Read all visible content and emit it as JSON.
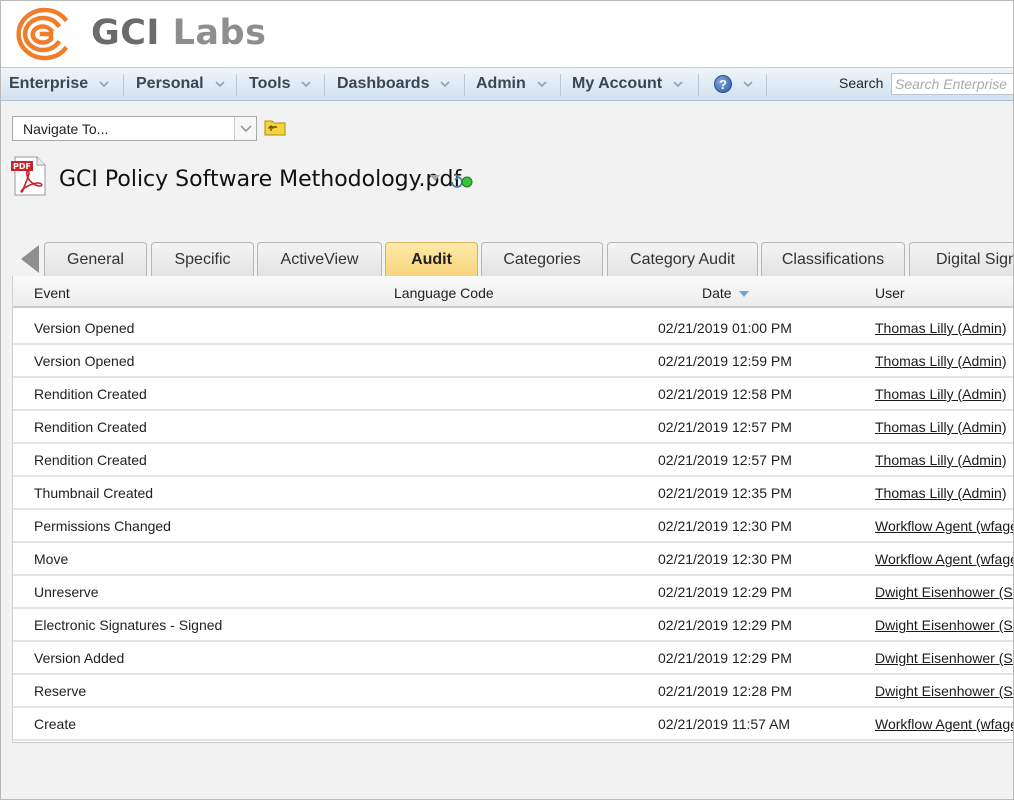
{
  "brand": {
    "name_bold": "GCI",
    "name_light": "Labs",
    "accent_color": "#f07d2a"
  },
  "nav": {
    "items": [
      {
        "label": "Enterprise"
      },
      {
        "label": "Personal"
      },
      {
        "label": "Tools"
      },
      {
        "label": "Dashboards"
      },
      {
        "label": "Admin"
      },
      {
        "label": "My Account"
      }
    ],
    "help_glyph": "?",
    "search_label": "Search",
    "search_placeholder": "Search Enterprise"
  },
  "navigate": {
    "selected": "Navigate To..."
  },
  "document": {
    "icon": "pdf-file-icon",
    "title": "GCI Policy Software Methodology.pdf"
  },
  "tabs": [
    {
      "label": "General"
    },
    {
      "label": "Specific"
    },
    {
      "label": "ActiveView"
    },
    {
      "label": "Audit",
      "active": true
    },
    {
      "label": "Categories"
    },
    {
      "label": "Category Audit"
    },
    {
      "label": "Classifications"
    },
    {
      "label": "Digital Signa"
    }
  ],
  "table": {
    "columns": {
      "event": "Event",
      "language": "Language Code",
      "date": "Date",
      "user": "User"
    },
    "sorted_by": "date",
    "rows": [
      {
        "event": "Version Opened",
        "date": "02/21/2019 01:00 PM",
        "user": "Thomas Lilly (Admin)"
      },
      {
        "event": "Version Opened",
        "date": "02/21/2019 12:59 PM",
        "user": "Thomas Lilly (Admin)"
      },
      {
        "event": "Rendition Created",
        "date": "02/21/2019 12:58 PM",
        "user": "Thomas Lilly (Admin)"
      },
      {
        "event": "Rendition Created",
        "date": "02/21/2019 12:57 PM",
        "user": "Thomas Lilly (Admin)"
      },
      {
        "event": "Rendition Created",
        "date": "02/21/2019 12:57 PM",
        "user": "Thomas Lilly (Admin)"
      },
      {
        "event": "Thumbnail Created",
        "date": "02/21/2019 12:35 PM",
        "user": "Thomas Lilly (Admin)"
      },
      {
        "event": "Permissions Changed",
        "date": "02/21/2019 12:30 PM",
        "user": "Workflow Agent (wfage"
      },
      {
        "event": "Move",
        "date": "02/21/2019 12:30 PM",
        "user": "Workflow Agent (wfage"
      },
      {
        "event": "Unreserve",
        "date": "02/21/2019 12:29 PM",
        "user": "Dwight Eisenhower (Sig"
      },
      {
        "event": "Electronic Signatures - Signed",
        "date": "02/21/2019 12:29 PM",
        "user": "Dwight Eisenhower (Sig"
      },
      {
        "event": "Version Added",
        "date": "02/21/2019 12:29 PM",
        "user": "Dwight Eisenhower (Sig"
      },
      {
        "event": "Reserve",
        "date": "02/21/2019 12:28 PM",
        "user": "Dwight Eisenhower (Sig"
      },
      {
        "event": "Create",
        "date": "02/21/2019 11:57 AM",
        "user": "Workflow Agent (wfage"
      }
    ]
  }
}
